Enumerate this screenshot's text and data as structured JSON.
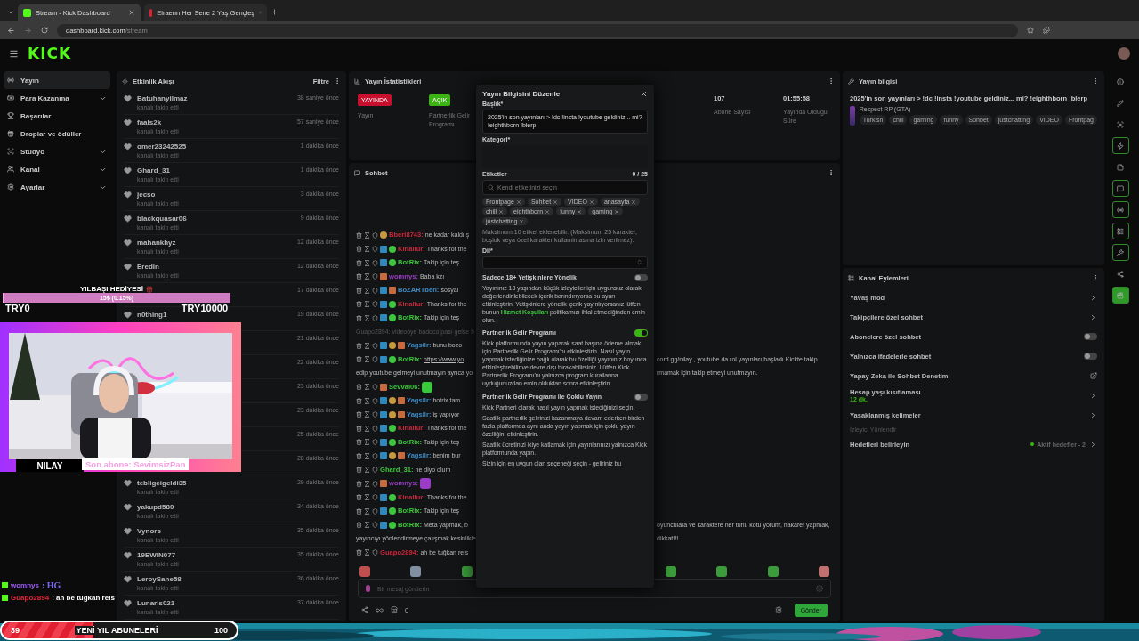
{
  "browser": {
    "tabs": [
      {
        "title": "Stream - Kick Dashboard",
        "selected": true,
        "kind": "kick"
      },
      {
        "title": "Elraenn Her Sene 2 Yaş Gençleş",
        "selected": false,
        "kind": "video"
      }
    ],
    "url_host": "dashboard.kick.com",
    "url_path": "/stream"
  },
  "logo": "KICK",
  "nav": [
    {
      "label": "Yayın",
      "selected": true,
      "kind": "broadcast",
      "has_menu": false
    },
    {
      "label": "Para Kazanma",
      "selected": false,
      "kind": "money",
      "has_menu": true
    },
    {
      "label": "Başarılar",
      "selected": false,
      "kind": "trophy",
      "has_menu": false
    },
    {
      "label": "Droplar ve ödüller",
      "selected": false,
      "kind": "gift",
      "has_menu": false
    },
    {
      "label": "Stüdyo",
      "selected": false,
      "kind": "studio",
      "has_menu": true
    },
    {
      "label": "Kanal",
      "selected": false,
      "kind": "channel",
      "has_menu": true
    },
    {
      "label": "Ayarlar",
      "selected": false,
      "kind": "settings",
      "has_menu": true
    }
  ],
  "feed": {
    "title": "Etkinlik Akışı",
    "filter": "Filtre",
    "items": [
      {
        "name": "Batuhanyilmaz",
        "action": "kanalı takip etti",
        "time": "38 saniye önce"
      },
      {
        "name": "faals2k",
        "action": "kanalı takip etti",
        "time": "57 saniye önce"
      },
      {
        "name": "omer23242525",
        "action": "kanalı takip etti",
        "time": "1 dakika önce"
      },
      {
        "name": "Ghard_31",
        "action": "kanalı takip etti",
        "time": "1 dakika önce"
      },
      {
        "name": "jecso",
        "action": "kanalı takip etti",
        "time": "3 dakika önce"
      },
      {
        "name": "blackquasar06",
        "action": "kanalı takip etti",
        "time": "9 dakika önce"
      },
      {
        "name": "mahankhyz",
        "action": "kanalı takip etti",
        "time": "12 dakika önce"
      },
      {
        "name": "Eredin",
        "action": "kanalı takip etti",
        "time": "12 dakika önce"
      },
      {
        "time": "17 dakika önce"
      },
      {
        "name": "n0thing1",
        "time": "19 dakika önce"
      },
      {
        "time": "21 dakika önce"
      },
      {
        "time": "22 dakika önce"
      },
      {
        "time": "23 dakika önce"
      },
      {
        "time": "23 dakika önce"
      },
      {
        "time": "25 dakika önce"
      },
      {
        "time": "28 dakika önce"
      },
      {
        "name": "tebligcigeldi35",
        "action": "kanalı takip etti",
        "time": "29 dakika önce"
      },
      {
        "name": "yakupd580",
        "action": "kanalı takip etti",
        "time": "34 dakika önce"
      },
      {
        "name": "Vynors",
        "action": "kanalı takip etti",
        "time": "35 dakika önce"
      },
      {
        "name": "19EWIN077",
        "action": "kanalı takip etti",
        "time": "35 dakika önce"
      },
      {
        "name": "LeroySane58",
        "action": "kanalı takip etti",
        "time": "36 dakika önce"
      },
      {
        "name": "Lunaris021",
        "action": "kanalı takip etti",
        "time": "37 dakika önce"
      }
    ]
  },
  "stats": {
    "title": "Yayın İstatistikleri",
    "cards": [
      {
        "kind": "badge",
        "badge": "YAYINDA",
        "color": "#c8102e",
        "label": "Yayın"
      },
      {
        "kind": "badge",
        "badge": "AÇIK",
        "color": "#3cb414",
        "label": "Partnerlik Gelir Programı"
      },
      {
        "kind": "value",
        "value": "107",
        "label": "Abone Sayısı"
      },
      {
        "kind": "value",
        "value": "01:55:58",
        "label": "Yayında Olduğu Süre"
      }
    ]
  },
  "chat": {
    "title": "Sohbet",
    "messages": [
      {
        "kind": "message",
        "user": "Bberi8743:",
        "color": "#c8283c",
        "badges": [
          {
            "kind": "sub"
          }
        ],
        "text": "ne kadar kaldı ş"
      },
      {
        "kind": "message",
        "user": "Kinallur:",
        "color": "#c8283c",
        "badges": [
          {
            "kind": "mod"
          },
          {
            "kind": "verified"
          }
        ],
        "text": "Thanks for the"
      },
      {
        "kind": "message",
        "user": "BotRix:",
        "color": "#3cc83c",
        "badges": [
          {
            "kind": "mod"
          },
          {
            "kind": "verified"
          }
        ],
        "text": "Takip için teş"
      },
      {
        "kind": "message",
        "user": "womnys:",
        "color": "#9b3cc8",
        "badges": [
          {
            "kind": "og"
          }
        ],
        "text": "Baba kzı"
      },
      {
        "kind": "message",
        "user": "BoZARTben:",
        "color": "#3c8cc8",
        "badges": [
          {
            "kind": "mod"
          },
          {
            "kind": "og"
          }
        ],
        "text": "sosyal"
      },
      {
        "kind": "message",
        "user": "Kinallur:",
        "color": "#c8283c",
        "badges": [
          {
            "kind": "mod"
          },
          {
            "kind": "verified"
          }
        ],
        "text": "Thanks for the"
      },
      {
        "kind": "message",
        "user": "BotRix:",
        "color": "#3cc83c",
        "badges": [
          {
            "kind": "mod"
          },
          {
            "kind": "verified"
          }
        ],
        "text": "Takip için teş"
      },
      {
        "kind": "reply",
        "text": "Guapo2894: videoöye badoco pası gelse b"
      },
      {
        "kind": "message",
        "user": "Yagsilr:",
        "color": "#3c8cc8",
        "badges": [
          {
            "kind": "mod"
          },
          {
            "kind": "sub"
          },
          {
            "kind": "og"
          }
        ],
        "text": "bunu bozo"
      },
      {
        "kind": "message",
        "user": "BotRix:",
        "color": "#3cc83c",
        "badges": [
          {
            "kind": "mod"
          },
          {
            "kind": "verified"
          }
        ],
        "link": "https://www.yo",
        "tail": "cord.gg/nilay , youtube da rol yayınları başladı Kickte takip",
        "line2": "edip youtube gelmeyi unutmayın ayrıca yo",
        "tail2": "rmamak için takip etmeyi unutmayın."
      },
      {
        "kind": "emote",
        "user": "Sevval06:",
        "color": "#3cc83c",
        "badges": [
          {
            "kind": "og"
          }
        ]
      },
      {
        "kind": "message",
        "user": "Yagsilr:",
        "color": "#3c8cc8",
        "badges": [
          {
            "kind": "mod"
          },
          {
            "kind": "sub"
          },
          {
            "kind": "og"
          }
        ],
        "text": "botrix tam"
      },
      {
        "kind": "message",
        "user": "Yagsilr:",
        "color": "#3c8cc8",
        "badges": [
          {
            "kind": "mod"
          },
          {
            "kind": "sub"
          },
          {
            "kind": "og"
          }
        ],
        "text": "iş yapıyor"
      },
      {
        "kind": "message",
        "user": "Kinallur:",
        "color": "#c8283c",
        "badges": [
          {
            "kind": "mod"
          },
          {
            "kind": "verified"
          }
        ],
        "text": "Thanks for the"
      },
      {
        "kind": "message",
        "user": "BotRix:",
        "color": "#3cc83c",
        "badges": [
          {
            "kind": "mod"
          },
          {
            "kind": "verified"
          }
        ],
        "text": "Takip için teş"
      },
      {
        "kind": "message",
        "user": "Yagsilr:",
        "color": "#3c8cc8",
        "badges": [
          {
            "kind": "mod"
          },
          {
            "kind": "sub"
          },
          {
            "kind": "og"
          }
        ],
        "text": "benim bur"
      },
      {
        "kind": "message",
        "user": "Ghard_31:",
        "color": "#3cc83c",
        "text": "ne diyo olum"
      },
      {
        "kind": "emote",
        "user": "womnys:",
        "color": "#9b3cc8",
        "badges": [
          {
            "kind": "og"
          }
        ]
      },
      {
        "kind": "message",
        "user": "Kinallur:",
        "color": "#c8283c",
        "badges": [
          {
            "kind": "mod"
          },
          {
            "kind": "verified"
          }
        ],
        "text": "Thanks for the"
      },
      {
        "kind": "message",
        "user": "BotRix:",
        "color": "#3cc83c",
        "badges": [
          {
            "kind": "mod"
          },
          {
            "kind": "verified"
          }
        ],
        "text": "Takip için teş"
      },
      {
        "kind": "message",
        "user": "BotRix:",
        "color": "#3cc83c",
        "badges": [
          {
            "kind": "mod"
          },
          {
            "kind": "verified"
          }
        ],
        "text": "Meta yapmak, b",
        "tail": "oyunculara ve karaktere her türlü kötü yorum, hakaret yapmak,",
        "line2": "yayıncıyı yönlendirmeye çalışmak kesinlikle",
        "tail2": "dikkat!!!"
      },
      {
        "kind": "message",
        "user": "Guapo2894:",
        "color": "#c8283c",
        "text": "ah be tuğkan reis"
      }
    ],
    "input_placeholder": "Bir mesaj gönderin",
    "count": "0",
    "send": "Gönder"
  },
  "modal": {
    "title": "Yayın Bilgisini Düzenle",
    "title_label": "Başlık*",
    "title_value": "2025'in son yayınları > !dc !insta !youtube geldiniz... mi? !eighthborn !blerp",
    "category_label": "Kategori*",
    "tags_label": "Etiketler",
    "tags_count": "0 / 25",
    "tags_placeholder": "Kendi etiketinizi seçin",
    "tags": [
      "Frontpage",
      "Sohbet",
      "VIDEO",
      "anasayfa",
      "chill",
      "eighthborn",
      "funny",
      "gaming",
      "justchatting"
    ],
    "tags_hint": "Maksimum 10 etiket eklenebilir. (Maksimum 25 karakter, boşluk veya özel karakter kullanılmasına izin verilmez).",
    "language_label": "Dil*",
    "options": [
      {
        "label": "Sadece 18+ Yetişkinlere Yönelik",
        "on": false,
        "paragraphs": [
          "Yayınınız 18 yaşından küçük izleyiciler için uygunsuz olarak değerlendirilebilecek içerik barındırıyorsa bu ayarı etkinleştirin. Yetişkinlere yönelik içerik yayınlıyorsanız lütfen bunun **Hizmet Koşulları** politikamızı ihlal etmediğinden emin olun."
        ]
      },
      {
        "label": "Partnerlik Gelir Programı",
        "on": true,
        "paragraphs": [
          "Kick platformunda yayın yaparak saat başına ödeme almak için Partnerlik Gelir Programı'nı etkinleştirin. Nasıl yayın yapmak istediğinize bağlı olarak bu özelliği yayınınız boyunca etkinleştirebilir ve devre dışı bırakabilirsiniz. Lütfen Kick Partnerlik Programı'nı yalnızca program kurallarına uyduğunuzdan emin olduktan sonra etkinleştirin."
        ]
      },
      {
        "label": "Partnerlik Gelir Programı ile Çoklu Yayın",
        "on": false,
        "paragraphs": [
          "Kick Partneri olarak nasıl yayın yapmak istediğinizi seçin.",
          "Saatlik partnerlik gelirinizi kazanmaya devam ederken birden fazla platformda aynı anda yayın yapmak için çoklu yayın özelliğini etkinleştirin.",
          "Saatlik ücretinizi ikiye katlamak için yayınlarınızı yalnızca Kick platformunda yapın.",
          "Sizin için en uygun olan seçeneği seçin - geliriniz bu"
        ]
      }
    ]
  },
  "stream_info": {
    "title": "Yayın bilgisi",
    "stream_title": "2025'in son yayınları > !dc !insta !youtube geldiniz... mi? !eighthborn !blerp",
    "category": "Respect RP (GTA)",
    "tags": [
      "Turkish",
      "chill",
      "gaming",
      "funny",
      "Sohbet",
      "justchatting",
      "VIDEO",
      "Frontpag"
    ]
  },
  "actions": {
    "title": "Kanal Eylemleri",
    "items": [
      {
        "kind": "chevron",
        "label": "Yavaş mod"
      },
      {
        "kind": "chevron",
        "label": "Takipçilere özel sohbet"
      },
      {
        "kind": "toggle",
        "label": "Abonelere özel sohbet",
        "on": false
      },
      {
        "kind": "toggle",
        "label": "Yalnızca ifadelerle sohbet",
        "on": false
      },
      {
        "kind": "external",
        "label": "Yapay Zeka ile Sohbet Denetimi"
      },
      {
        "kind": "chevron",
        "label": "Hesap yaşı kısıtlaması",
        "sub": "12 dk."
      },
      {
        "kind": "chevron",
        "label": "Yasaklanmış kelimeler"
      },
      {
        "kind": "section",
        "label": "İzleyici Yönlendir"
      },
      {
        "kind": "chevron",
        "label": "Hedefleri belirleyin",
        "status": "Aktif hedefler - 2"
      }
    ]
  },
  "rail": [
    {
      "kind": "info",
      "active": false
    },
    {
      "kind": "pen",
      "active": false
    },
    {
      "kind": "focus",
      "active": false
    },
    {
      "kind": "bolt",
      "active": true
    },
    {
      "kind": "note",
      "active": false
    },
    {
      "kind": "chat",
      "active": true
    },
    {
      "kind": "broadcast",
      "active": true
    },
    {
      "kind": "layout",
      "active": true
    },
    {
      "kind": "wrench",
      "active": true
    },
    {
      "kind": "share",
      "active": false
    },
    {
      "kind": "clapper",
      "active": true,
      "selected": true
    }
  ],
  "goal": {
    "title": "YILBAŞI HEDİYESİ",
    "amount": "15₺ (0.15%)",
    "level": 0.0015,
    "min": "TRY0",
    "max": "TRY10000"
  },
  "cam": {
    "name": "NILAY",
    "last_sub": "Son abone: SevimsizPan"
  },
  "overlay_chat": [
    {
      "user": "womnys",
      "color": "#9b5cf0",
      "text": ": HG",
      "kind": "emote"
    },
    {
      "user": "Guapo2894",
      "color": "#e0283c",
      "text": ": ah be tuğkan reis",
      "kind": "text"
    }
  ],
  "sub_goal": {
    "current": "39",
    "title": "YENİ YIL ABUNELERİ",
    "target": "100",
    "level": 0.39
  }
}
